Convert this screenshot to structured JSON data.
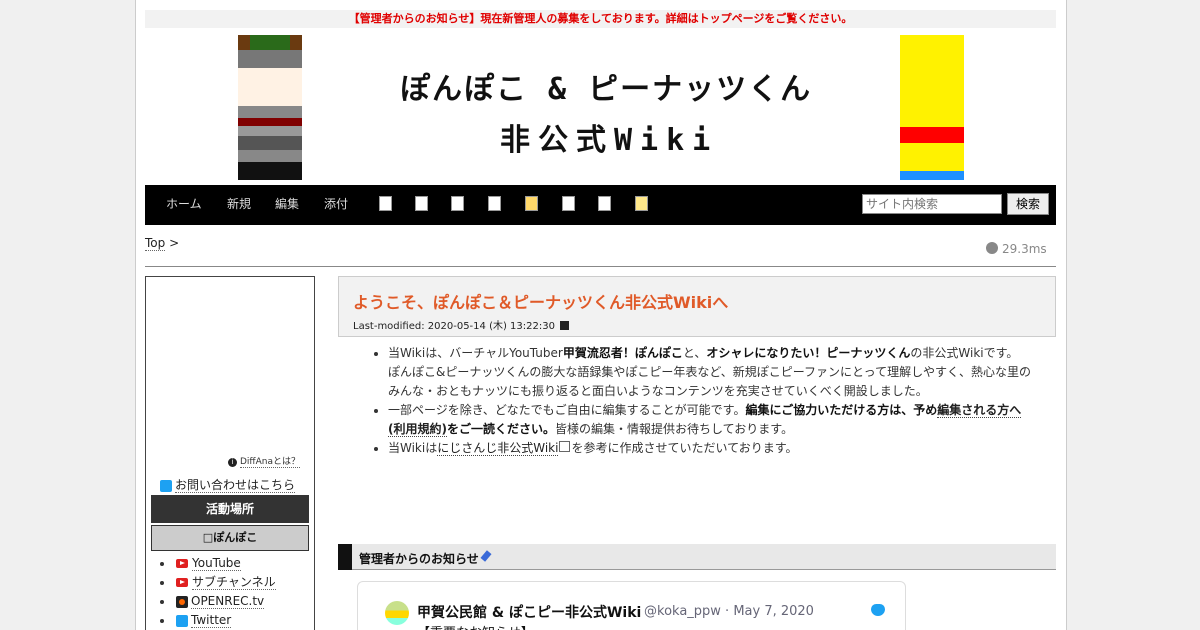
{
  "notice": "【管理者からのお知らせ】現在新管理人の募集をしております。詳細はトップページをご覧ください。",
  "banner": {
    "line1": "ぽんぽこ & ピーナッツくん",
    "line2": "非公式Wiki"
  },
  "nav": {
    "links": [
      "ホーム",
      "新規",
      "編集",
      "添付"
    ],
    "search_placeholder": "サイト内検索",
    "search_button": "検索"
  },
  "breadcrumb": {
    "top": "Top",
    "sep": ">"
  },
  "timing": "29.3ms",
  "sidebar": {
    "diffana": "DiffAnaとは？",
    "contact": "お問い合わせはこちら",
    "section_dark": "活動場所",
    "section_grey": "□ぽんぽこ",
    "items": [
      {
        "label": "YouTube",
        "icon": "youtube-icon"
      },
      {
        "label": "サブチャンネル",
        "icon": "youtube-icon"
      },
      {
        "label": "OPENREC.tv",
        "icon": "openrec-icon"
      },
      {
        "label": "Twitter",
        "icon": "twitter-icon"
      }
    ]
  },
  "page": {
    "title": "ようこそ、ぽんぽこ＆ピーナッツくん非公式Wikiへ",
    "last_modified": "Last-modified: 2020-05-14 (木) 13:22:30"
  },
  "content": {
    "p1_a": "当Wikiは、バーチャルYouTuber",
    "p1_b": "甲賀流忍者！ぽんぽこ",
    "p1_c": "と、",
    "p1_d": "オシャレになりたい！ピーナッツくん",
    "p1_e": "の非公式Wikiです。",
    "p1_f": "ぽんぽこ&ピーナッツくんの膨大な語録集やぽこピー年表など、新規ぽこピーファンにとって理解しやすく、熱心な里のみんな・おともナッツにも振り返ると面白いようなコンテンツを充実させていくべく開設しました。",
    "p2_a": "一部ページを除き、どなたでもご自由に編集することが可能です。",
    "p2_b": "編集にご協力いただける方は、予め",
    "p2_c": "編集される方へ(利用規約)",
    "p2_d": "をご一読ください。",
    "p2_e": "皆様の編集・情報提供お待ちしております。",
    "p3_a": "当Wikiは",
    "p3_b": "にじさんじ非公式Wiki",
    "p3_c": "を参考に作成させていただいております。"
  },
  "section": {
    "title": "管理者からのお知らせ"
  },
  "tweet": {
    "name": "甲賀公民館 & ぽこピー非公式Wiki",
    "handle": "@koka_ppw · May 7, 2020",
    "body": "【重要なお知らせ】"
  }
}
